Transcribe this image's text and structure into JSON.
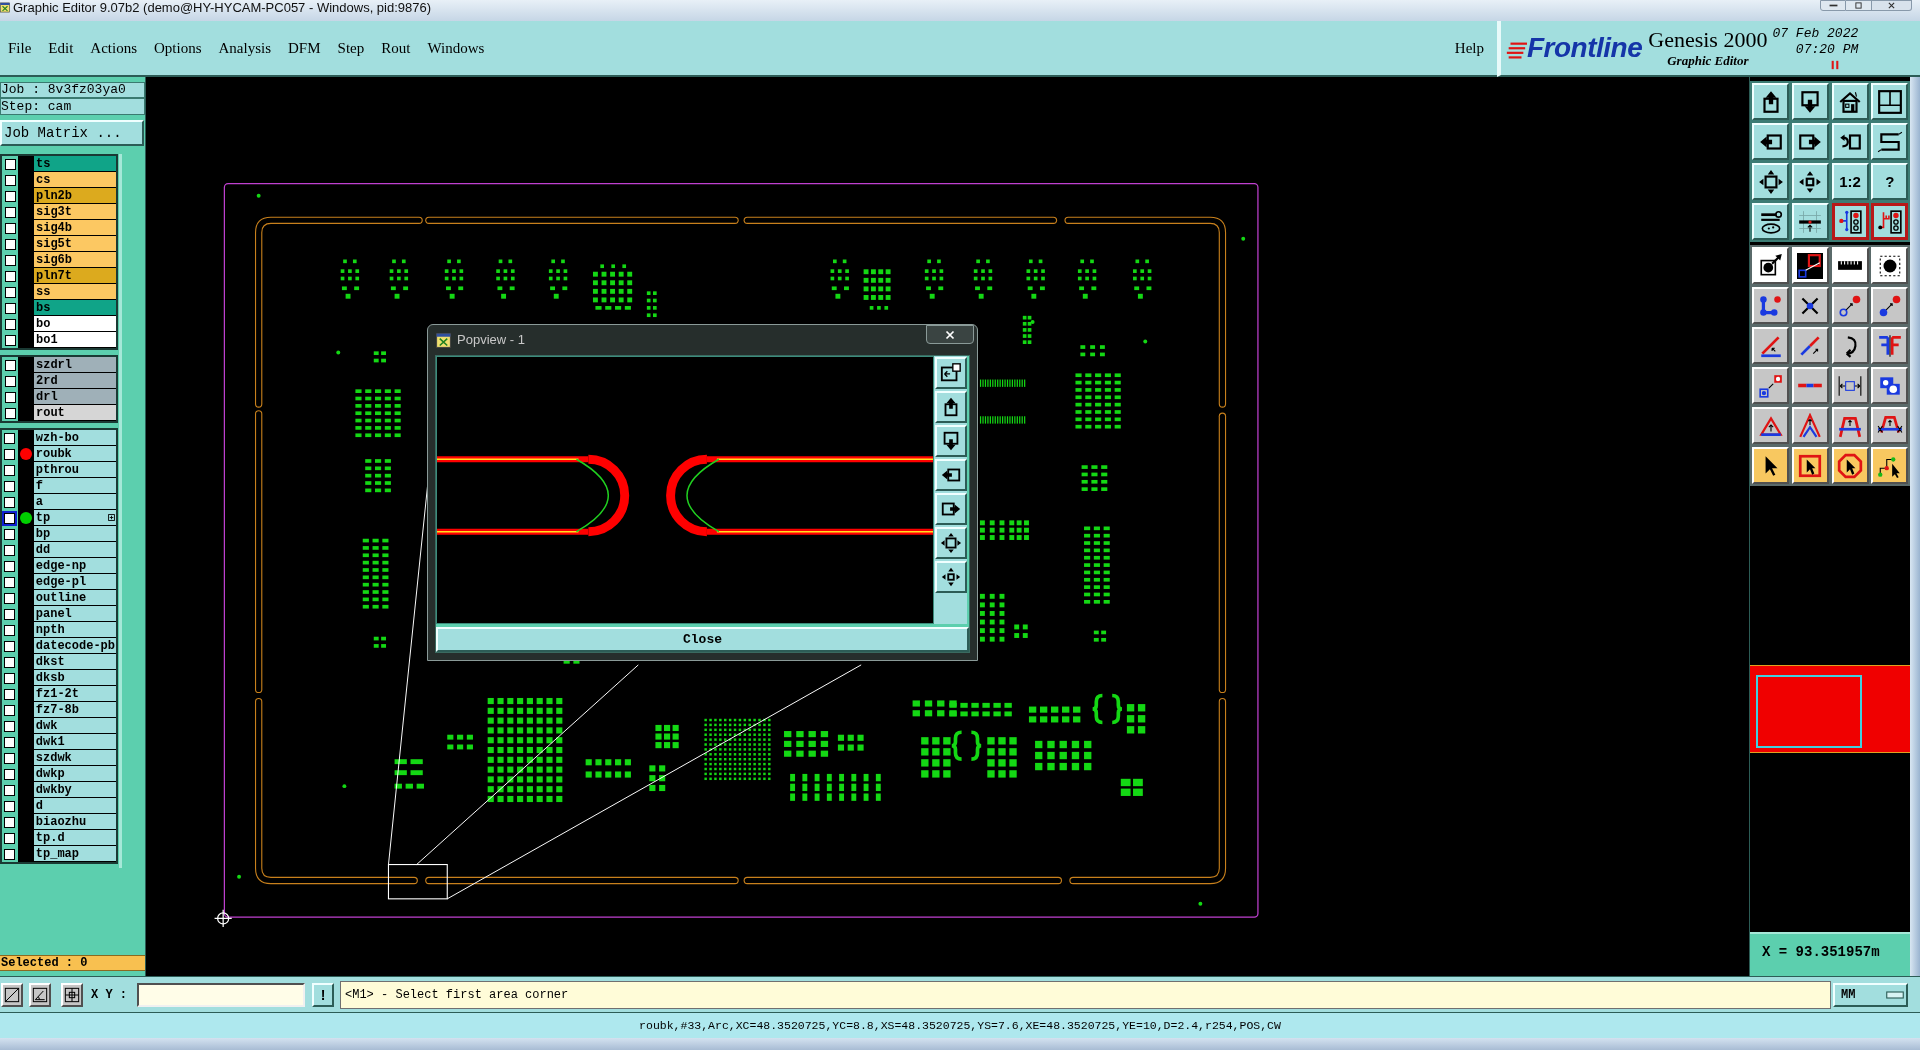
{
  "window": {
    "title": "Graphic Editor 9.07b2 (demo@HY-HYCAM-PC057 - Windows, pid:9876)"
  },
  "menu": [
    "File",
    "Edit",
    "Actions",
    "Options",
    "Analysis",
    "DFM",
    "Step",
    "Rout",
    "Windows"
  ],
  "help": "Help",
  "brand": {
    "logo": "Frontline",
    "product": "Genesis 2000",
    "module": "Graphic Editor",
    "date": "07 Feb 2022",
    "time": "07:20 PM"
  },
  "job": "Job : 8v3fz03ya0",
  "step": "Step: cam",
  "matrix_button": "Job Matrix ...",
  "layer_groups": [
    {
      "layers": [
        {
          "name": "ts",
          "color": "#10a488",
          "checked": false,
          "selected": false
        },
        {
          "name": "cs",
          "color": "#fcc862",
          "checked": false,
          "selected": false
        },
        {
          "name": "pln2b",
          "color": "#dcaa1e",
          "checked": false,
          "selected": false
        },
        {
          "name": "sig3t",
          "color": "#fcc862",
          "checked": false,
          "selected": false
        },
        {
          "name": "sig4b",
          "color": "#fcc862",
          "checked": false,
          "selected": false
        },
        {
          "name": "sig5t",
          "color": "#fcc862",
          "checked": false,
          "selected": false
        },
        {
          "name": "sig6b",
          "color": "#fcc862",
          "checked": false,
          "selected": false
        },
        {
          "name": "pln7t",
          "color": "#dcaa1e",
          "checked": false,
          "selected": false
        },
        {
          "name": "ss",
          "color": "#fcc862",
          "checked": false,
          "selected": false
        },
        {
          "name": "bs",
          "color": "#10a488",
          "checked": false,
          "selected": false
        },
        {
          "name": "bo",
          "color": "#ffffff",
          "checked": false,
          "selected": false
        },
        {
          "name": "bo1",
          "color": "#ffffff",
          "checked": false,
          "selected": false
        }
      ]
    },
    {
      "layers": [
        {
          "name": "szdrl",
          "color": "#9fb0b8",
          "checked": false,
          "selected": false
        },
        {
          "name": "2rd",
          "color": "#9fb0b8",
          "checked": false,
          "selected": false
        },
        {
          "name": "drl",
          "color": "#9fb0b8",
          "checked": false,
          "selected": false
        },
        {
          "name": "rout",
          "color": "#d6d6d6",
          "checked": false,
          "selected": false
        }
      ]
    },
    {
      "layers": [
        {
          "name": "wzh-bo",
          "color": "#a2dede",
          "checked": false,
          "selected": false
        },
        {
          "name": "roubk",
          "color": "#a2dede",
          "checked": false,
          "selected": false,
          "dot": {
            "color": "#ff0000"
          }
        },
        {
          "name": "pthrou",
          "color": "#a2dede",
          "checked": false,
          "selected": false
        },
        {
          "name": "f",
          "color": "#a2dede",
          "checked": false,
          "selected": false
        },
        {
          "name": "a",
          "color": "#a2dede",
          "checked": false,
          "selected": false
        },
        {
          "name": "tp",
          "color": "#a2dede",
          "checked": false,
          "selected": true,
          "dot": {
            "color": "#00d000"
          }
        },
        {
          "name": "bp",
          "color": "#a2dede",
          "checked": false,
          "selected": false
        },
        {
          "name": "dd",
          "color": "#a2dede",
          "checked": false,
          "selected": false
        },
        {
          "name": "edge-np",
          "color": "#a2dede",
          "checked": false,
          "selected": false
        },
        {
          "name": "edge-pl",
          "color": "#a2dede",
          "checked": false,
          "selected": false
        },
        {
          "name": "outline",
          "color": "#a2dede",
          "checked": false,
          "selected": false
        },
        {
          "name": "panel",
          "color": "#a2dede",
          "checked": false,
          "selected": false
        },
        {
          "name": "npth",
          "color": "#a2dede",
          "checked": false,
          "selected": false
        },
        {
          "name": "datecode-pb",
          "color": "#a2dede",
          "checked": false,
          "selected": false
        },
        {
          "name": "dkst",
          "color": "#a2dede",
          "checked": false,
          "selected": false
        },
        {
          "name": "dksb",
          "color": "#a2dede",
          "checked": false,
          "selected": false
        },
        {
          "name": "fz1-2t",
          "color": "#a2dede",
          "checked": false,
          "selected": false
        },
        {
          "name": "fz7-8b",
          "color": "#a2dede",
          "checked": false,
          "selected": false
        },
        {
          "name": "dwk",
          "color": "#a2dede",
          "checked": false,
          "selected": false
        },
        {
          "name": "dwk1",
          "color": "#a2dede",
          "checked": false,
          "selected": false
        },
        {
          "name": "szdwk",
          "color": "#a2dede",
          "checked": false,
          "selected": false
        },
        {
          "name": "dwkp",
          "color": "#a2dede",
          "checked": false,
          "selected": false
        },
        {
          "name": "dwkby",
          "color": "#a2dede",
          "checked": false,
          "selected": false
        },
        {
          "name": "d",
          "color": "#a2dede",
          "checked": false,
          "selected": false
        },
        {
          "name": "biaozhu",
          "color": "#a2dede",
          "checked": false,
          "selected": false
        },
        {
          "name": "tp.d",
          "color": "#a2dede",
          "checked": false,
          "selected": false
        },
        {
          "name": "tp_map",
          "color": "#a2dede",
          "checked": false,
          "selected": false
        }
      ]
    }
  ],
  "selected_count": "Selected : 0",
  "toolbar": [
    {
      "kind": "view",
      "on": false
    },
    {
      "kind": "view",
      "on": false
    },
    {
      "kind": "view",
      "on": false
    },
    {
      "kind": "view",
      "on": false
    },
    {
      "kind": "view",
      "on": false
    },
    {
      "kind": "view",
      "on": false
    },
    {
      "kind": "view",
      "on": false
    },
    {
      "kind": "view",
      "on": false
    },
    {
      "kind": "view",
      "on": false
    },
    {
      "kind": "view",
      "on": false
    },
    {
      "kind": "view",
      "on": false,
      "label": "1:2"
    },
    {
      "kind": "view",
      "on": false,
      "label": "?"
    },
    {
      "kind": "view",
      "on": false
    },
    {
      "kind": "view",
      "on": false
    },
    {
      "kind": "view",
      "on": true
    },
    {
      "kind": "view",
      "on": true
    },
    {
      "kind": "display",
      "on": false
    },
    {
      "kind": "display",
      "on": false
    },
    {
      "kind": "display",
      "on": false
    },
    {
      "kind": "display",
      "on": false
    },
    {
      "kind": "edit",
      "on": false
    },
    {
      "kind": "edit",
      "on": false
    },
    {
      "kind": "edit",
      "on": false
    },
    {
      "kind": "edit",
      "on": false
    },
    {
      "kind": "edit",
      "on": false
    },
    {
      "kind": "edit",
      "on": false
    },
    {
      "kind": "edit",
      "on": false
    },
    {
      "kind": "edit",
      "on": false
    },
    {
      "kind": "edit",
      "on": false
    },
    {
      "kind": "edit",
      "on": false
    },
    {
      "kind": "edit",
      "on": false
    },
    {
      "kind": "edit",
      "on": false
    },
    {
      "kind": "edit",
      "on": false
    },
    {
      "kind": "edit",
      "on": false
    },
    {
      "kind": "edit",
      "on": false
    },
    {
      "kind": "edit",
      "on": false
    },
    {
      "kind": "select",
      "on": false
    },
    {
      "kind": "select",
      "on": false
    },
    {
      "kind": "select",
      "on": false
    },
    {
      "kind": "select",
      "on": false
    }
  ],
  "popview": {
    "title": "Popview - 1",
    "close_button": "Close"
  },
  "x_readout": "X = 93.351957m",
  "command_bar": {
    "label": "X Y :",
    "apply_button": "!",
    "prompt": "<M1> - Select first area corner",
    "units": "MM"
  },
  "status_line": "roubk,#33,Arc,XC=48.3520725,YC=8.8,XS=48.3520725,YS=7.6,XE=48.3520725,YE=10,D=2.4,r254,POS,CW"
}
